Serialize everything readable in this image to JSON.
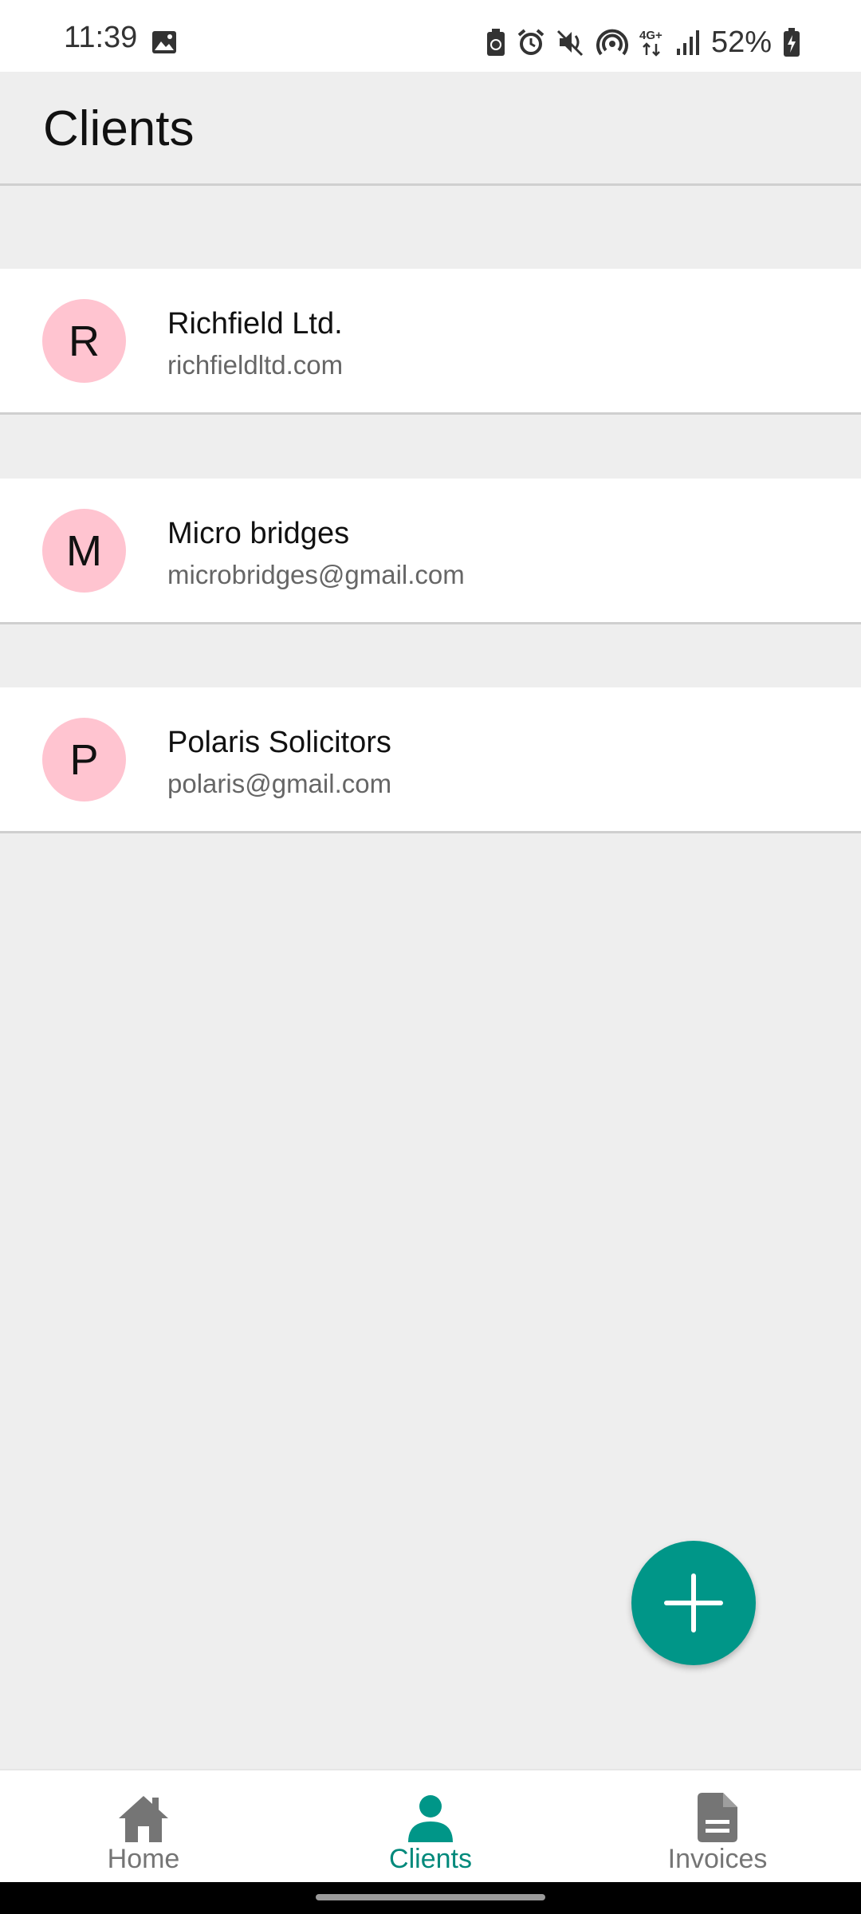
{
  "status_bar": {
    "time": "11:39",
    "battery": "52%",
    "network": "4G+",
    "icons": [
      "image-icon",
      "battery-saver-icon",
      "alarm-icon",
      "mute-icon",
      "hotspot-icon",
      "network-4g-icon",
      "signal-icon",
      "battery-charging-icon"
    ]
  },
  "header": {
    "title": "Clients"
  },
  "clients": [
    {
      "initial": "R",
      "name": "Richfield Ltd.",
      "contact": "richfieldltd.com"
    },
    {
      "initial": "M",
      "name": "Micro bridges",
      "contact": "microbridges@gmail.com"
    },
    {
      "initial": "P",
      "name": "Polaris Solicitors",
      "contact": "polaris@gmail.com"
    }
  ],
  "fab": {
    "icon": "plus-icon"
  },
  "bottom_nav": {
    "items": [
      {
        "label": "Home",
        "icon": "home-icon",
        "active": false
      },
      {
        "label": "Clients",
        "icon": "person-icon",
        "active": true
      },
      {
        "label": "Invoices",
        "icon": "document-icon",
        "active": false
      }
    ]
  },
  "colors": {
    "accent": "#009688",
    "avatar_bg": "#ffc4d0",
    "background": "#eeeeee"
  }
}
